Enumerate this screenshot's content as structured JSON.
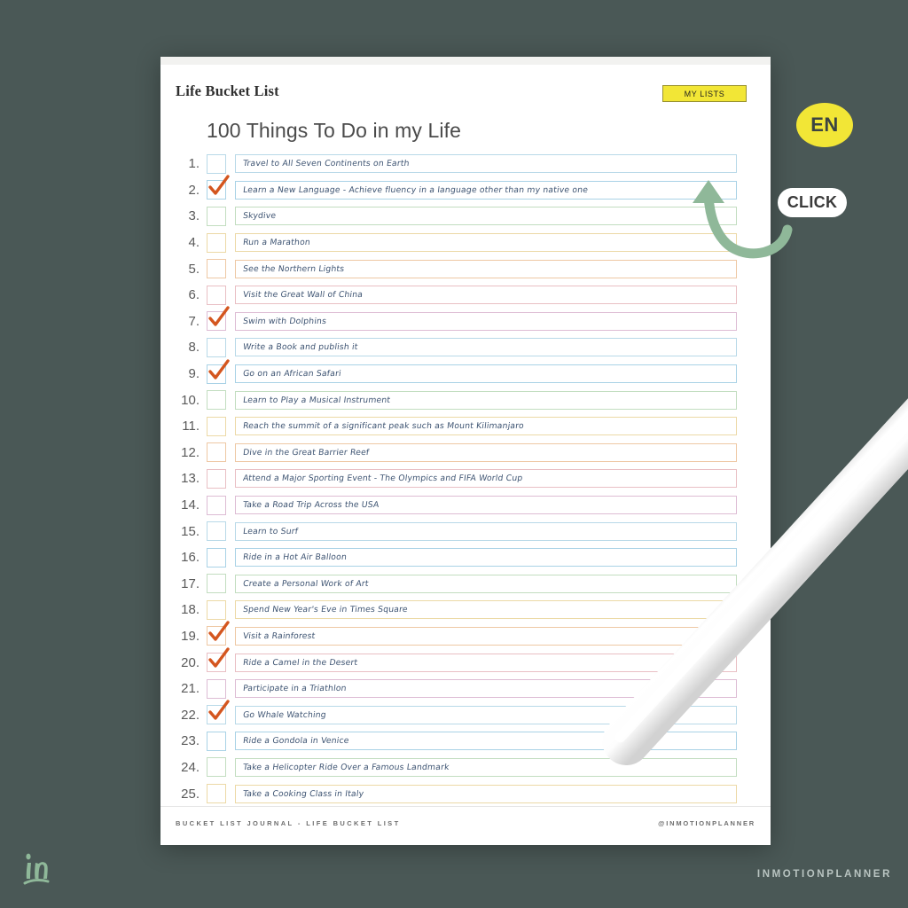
{
  "theme": {
    "background": "#4a5856",
    "accent_yellow": "#f2e636",
    "text_blue": "#3f5573",
    "tick_orange": "#d4561f",
    "arrow_green": "#8fb899"
  },
  "header": {
    "brand_title": "Life Bucket List",
    "my_lists_label": "MY LISTS"
  },
  "page_heading": "100 Things To Do in my Life",
  "overlays": {
    "language_badge": "EN",
    "click_label": "CLICK",
    "watermark_logo": "in-logo-icon",
    "watermark_text": "INMOTIONPLANNER"
  },
  "footer": {
    "left": "BUCKET LIST JOURNAL - LIFE BUCKET LIST",
    "right": "@INMOTIONPLANNER"
  },
  "list": {
    "palette": [
      "#b8d9e8",
      "#a9d2e6",
      "#c2ddc0",
      "#ecd9a6",
      "#eec8a4",
      "#e9bfc4",
      "#ddbcd4"
    ],
    "items": [
      {
        "number": "1.",
        "text": "Travel to All Seven Continents on Earth",
        "checked": false
      },
      {
        "number": "2.",
        "text": "Learn a New Language - Achieve fluency in a language other than my native one",
        "checked": true
      },
      {
        "number": "3.",
        "text": "Skydive",
        "checked": false
      },
      {
        "number": "4.",
        "text": "Run a Marathon",
        "checked": false
      },
      {
        "number": "5.",
        "text": "See the Northern Lights",
        "checked": false
      },
      {
        "number": "6.",
        "text": "Visit the Great Wall of China",
        "checked": false
      },
      {
        "number": "7.",
        "text": "Swim with Dolphins",
        "checked": true
      },
      {
        "number": "8.",
        "text": "Write a Book and publish it",
        "checked": false
      },
      {
        "number": "9.",
        "text": "Go on an African Safari",
        "checked": true
      },
      {
        "number": "10.",
        "text": "Learn to Play a Musical Instrument",
        "checked": false
      },
      {
        "number": "11.",
        "text": "Reach the summit of a significant peak such as Mount Kilimanjaro",
        "checked": false
      },
      {
        "number": "12.",
        "text": "Dive in the Great Barrier Reef",
        "checked": false
      },
      {
        "number": "13.",
        "text": "Attend a Major Sporting Event - The Olympics and FIFA World Cup",
        "checked": false
      },
      {
        "number": "14.",
        "text": "Take a Road Trip Across the USA",
        "checked": false
      },
      {
        "number": "15.",
        "text": "Learn to Surf",
        "checked": false
      },
      {
        "number": "16.",
        "text": "Ride in a Hot Air Balloon",
        "checked": false
      },
      {
        "number": "17.",
        "text": "Create a Personal Work of Art",
        "checked": false
      },
      {
        "number": "18.",
        "text": "Spend New Year's Eve in Times Square",
        "checked": false
      },
      {
        "number": "19.",
        "text": "Visit a Rainforest",
        "checked": true
      },
      {
        "number": "20.",
        "text": "Ride a Camel in the Desert",
        "checked": true
      },
      {
        "number": "21.",
        "text": "Participate in a Triathlon",
        "checked": false
      },
      {
        "number": "22.",
        "text": "Go Whale Watching",
        "checked": true
      },
      {
        "number": "23.",
        "text": "Ride a Gondola in Venice",
        "checked": false
      },
      {
        "number": "24.",
        "text": "Take a Helicopter Ride Over a Famous Landmark",
        "checked": false
      },
      {
        "number": "25.",
        "text": "Take a Cooking Class in Italy",
        "checked": false
      }
    ]
  }
}
